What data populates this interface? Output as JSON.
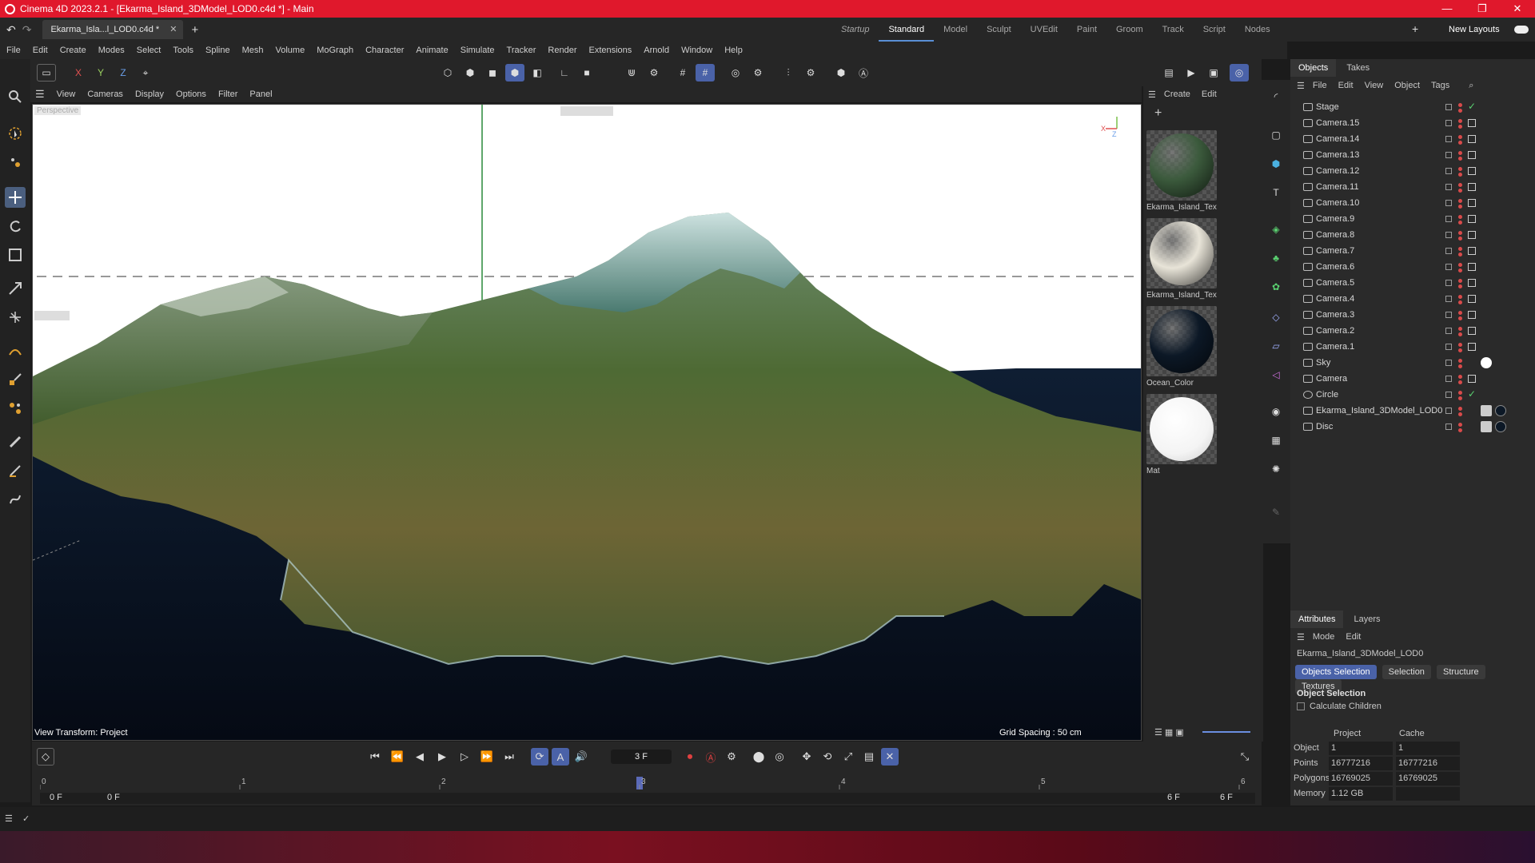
{
  "window": {
    "title": "Cinema 4D 2023.2.1 - [Ekarma_Island_3DModel_LOD0.c4d *] - Main",
    "controls": [
      "—",
      "❐",
      "✕"
    ]
  },
  "doc_tab": {
    "label": "Ekarma_Isla...l_LOD0.c4d *",
    "close": "✕",
    "add": "+"
  },
  "layouts": [
    "Startup",
    "Standard",
    "Model",
    "Sculpt",
    "UVEdit",
    "Paint",
    "Groom",
    "Track",
    "Script",
    "Nodes"
  ],
  "active_layout": "Standard",
  "new_layouts": "New Layouts",
  "menu": [
    "File",
    "Edit",
    "Create",
    "Modes",
    "Select",
    "Tools",
    "Spline",
    "Mesh",
    "Volume",
    "MoGraph",
    "Character",
    "Animate",
    "Simulate",
    "Tracker",
    "Render",
    "Extensions",
    "Arnold",
    "Window",
    "Help"
  ],
  "axis_buttons": {
    "x": "X",
    "y": "Y",
    "z": "Z"
  },
  "viewport_menu": [
    "View",
    "Cameras",
    "Display",
    "Options",
    "Filter",
    "Panel"
  ],
  "viewport": {
    "camera_label": "Perspective",
    "view_transform": "View Transform: Project",
    "grid_spacing": "Grid Spacing : 50 cm"
  },
  "material_menu": [
    "Create",
    "Edit"
  ],
  "materials": [
    {
      "name": "Ekarma_Island_Tex",
      "color": "#3b5a3c"
    },
    {
      "name": "Ekarma_Island_Tex",
      "color": "#e8e4d8"
    },
    {
      "name": "Ocean_Color",
      "color": "#0c1826"
    },
    {
      "name": "Mat",
      "color": "#ffffff"
    }
  ],
  "objects_panel": {
    "tabs": [
      "Objects",
      "Takes"
    ],
    "menu": [
      "File",
      "Edit",
      "View",
      "Object",
      "Tags"
    ],
    "items": [
      "Stage",
      "Camera.15",
      "Camera.14",
      "Camera.13",
      "Camera.12",
      "Camera.11",
      "Camera.10",
      "Camera.9",
      "Camera.8",
      "Camera.7",
      "Camera.6",
      "Camera.5",
      "Camera.4",
      "Camera.3",
      "Camera.2",
      "Camera.1",
      "Sky",
      "Camera",
      "Circle",
      "Ekarma_Island_3DModel_LOD0",
      "Disc"
    ]
  },
  "attributes": {
    "tabs": [
      "Attributes",
      "Layers"
    ],
    "menu": [
      "Mode",
      "Edit"
    ],
    "object_name": "Ekarma_Island_3DModel_LOD0",
    "buttons": [
      "Objects Selection",
      "Selection",
      "Structure",
      "Textures"
    ],
    "section": "Object Selection",
    "calc_children": "Calculate Children",
    "col_project": "Project",
    "col_cache": "Cache",
    "rows": [
      {
        "label": "Object",
        "project": "1",
        "cache": "1"
      },
      {
        "label": "Points",
        "project": "16777216",
        "cache": "16777216"
      },
      {
        "label": "Polygons",
        "project": "16769025",
        "cache": "16769025"
      },
      {
        "label": "Memory",
        "project": "1.12 GB",
        "cache": ""
      }
    ]
  },
  "timeline": {
    "current_frame": "3 F",
    "start": "0 F",
    "start2": "0 F",
    "end": "6 F",
    "end2": "6 F",
    "ticks": [
      "0",
      "1",
      "2",
      "3",
      "4",
      "5",
      "6"
    ],
    "playhead_frame": 3,
    "max_frame": 6
  }
}
